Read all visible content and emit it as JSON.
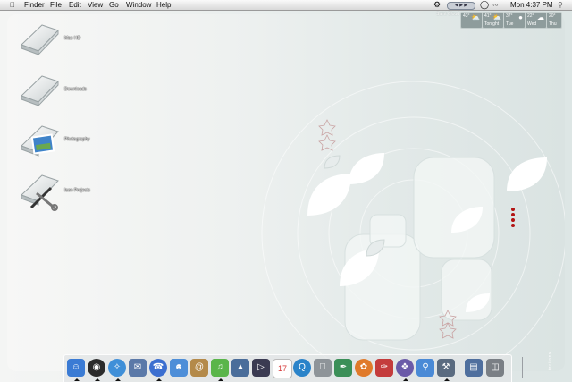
{
  "menubar": {
    "apple_icon": "apple-icon",
    "menus": [
      "Finder",
      "File",
      "Edit",
      "View",
      "Go",
      "Window",
      "Help"
    ],
    "clock": "Mon 4:37 PM",
    "status_icons": [
      "gear-icon",
      "media-controls-icon",
      "chat-bubble-icon",
      "wifi-icon",
      "spotlight-icon"
    ]
  },
  "weather": {
    "city": "Saint Cloud",
    "days": [
      {
        "temp": "43°",
        "day": "",
        "icon": "partly-cloudy-icon"
      },
      {
        "temp": "41°",
        "day": "Tonight",
        "icon": "partly-cloudy-icon"
      },
      {
        "temp": "37°",
        "day": "Tue",
        "icon": "moon-icon"
      },
      {
        "temp": "22°",
        "day": "Wed",
        "icon": "cloudy-icon"
      },
      {
        "temp": "20°",
        "day": "Thu",
        "icon": "snow-icon"
      }
    ]
  },
  "desktop_icons": [
    {
      "label": "Mac HD",
      "icon": "hard-drive-icon"
    },
    {
      "label": "Downloads",
      "icon": "hard-drive-icon"
    },
    {
      "label": "Photography",
      "icon": "photo-drive-icon"
    },
    {
      "label": "Icon Projects",
      "icon": "tools-drive-icon"
    }
  ],
  "dock": {
    "apps": [
      {
        "name": "Finder",
        "icon": "finder-icon",
        "running": true,
        "color": "#3b7bd4"
      },
      {
        "name": "Dashboard",
        "icon": "dashboard-icon",
        "running": true,
        "color": "#2b2b2b"
      },
      {
        "name": "Safari",
        "icon": "safari-icon",
        "running": true,
        "color": "#3f8fd8"
      },
      {
        "name": "Mail",
        "icon": "mail-icon",
        "running": false,
        "color": "#5b79a8"
      },
      {
        "name": "iChat",
        "icon": "ichat-icon",
        "running": true,
        "color": "#3c6fd0"
      },
      {
        "name": "Messenger",
        "icon": "messenger-icon",
        "running": false,
        "color": "#4d8ed8"
      },
      {
        "name": "Address Book",
        "icon": "address-book-icon",
        "running": false,
        "color": "#b48a4a"
      },
      {
        "name": "iTunes",
        "icon": "itunes-icon",
        "running": true,
        "color": "#5ab54a"
      },
      {
        "name": "iPhoto",
        "icon": "iphoto-icon",
        "running": false,
        "color": "#4a6d9a"
      },
      {
        "name": "iMovie",
        "icon": "imovie-icon",
        "running": false,
        "color": "#3b3b52"
      },
      {
        "name": "iCal",
        "icon": "ical-icon",
        "running": false,
        "color": "#d63a3a"
      },
      {
        "name": "QuickTime",
        "icon": "quicktime-icon",
        "running": false,
        "color": "#2a83c9"
      },
      {
        "name": "System Preferences",
        "icon": "system-preferences-icon",
        "running": false,
        "color": "#8e9499"
      },
      {
        "name": "Script Editor",
        "icon": "quill-icon",
        "running": false,
        "color": "#3b8f58"
      },
      {
        "name": "Photo Booth",
        "icon": "flower-icon",
        "running": false,
        "color": "#e07a2a"
      },
      {
        "name": "Text Editor",
        "icon": "pen-icon",
        "running": false,
        "color": "#c43c3c"
      },
      {
        "name": "Camino",
        "icon": "bird-icon",
        "running": true,
        "color": "#6a5aa8"
      },
      {
        "name": "Preview",
        "icon": "magnifier-icon",
        "running": false,
        "color": "#4a8ad6"
      },
      {
        "name": "Terminal",
        "icon": "tools-icon",
        "running": true,
        "color": "#5a6b80"
      }
    ],
    "stack": {
      "name": "Documents",
      "icon": "folder-stack-icon",
      "color": "#4f6f9e"
    },
    "trash": {
      "name": "Trash",
      "icon": "trash-icon",
      "color": "#7a7f85"
    }
  },
  "wallpaper": {
    "watermark": "waterlines"
  }
}
